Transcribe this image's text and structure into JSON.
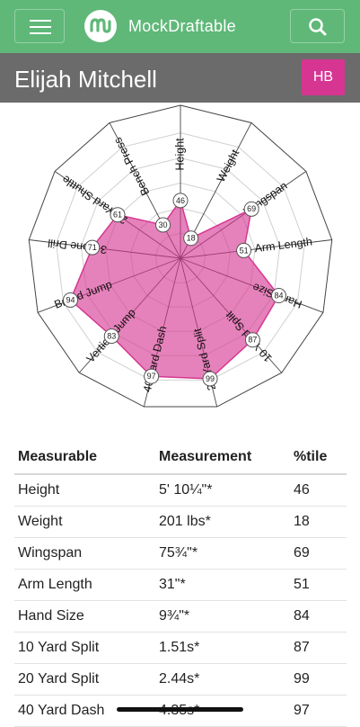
{
  "header": {
    "brand": "MockDraftable",
    "menu_icon": "hamburger-menu-icon",
    "logo_icon": "mockdraftable-logo-icon",
    "search_icon": "search-icon",
    "colors": {
      "header_bg": "#5fb878",
      "name_bar_bg": "#6b6b6b",
      "position_badge": "#d63692",
      "radar_fill": "#d63692"
    }
  },
  "player": {
    "name": "Elijah Mitchell",
    "position": "HB"
  },
  "chart_data": {
    "type": "radar",
    "max": 100,
    "axes": [
      {
        "label": "Height",
        "value": 46
      },
      {
        "label": "Weight",
        "value": 18
      },
      {
        "label": "Wingspan",
        "value": 69
      },
      {
        "label": "Arm Length",
        "value": 51
      },
      {
        "label": "Hand Size",
        "value": 84
      },
      {
        "label": "10 Yard Split",
        "value": 87
      },
      {
        "label": "20 Yard Split",
        "value": 99
      },
      {
        "label": "40 Yard Dash",
        "value": 97
      },
      {
        "label": "Vertical Jump",
        "value": 83
      },
      {
        "label": "Broad Jump",
        "value": 94
      },
      {
        "label": "3-Cone Drill",
        "value": 71
      },
      {
        "label": "20 Yard Shuttle",
        "value": 61
      },
      {
        "label": "Bench Press",
        "value": 30
      }
    ]
  },
  "table": {
    "headers": [
      "Measurable",
      "Measurement",
      "%tile"
    ],
    "rows": [
      [
        "Height",
        "5' 10¼\"*",
        "46"
      ],
      [
        "Weight",
        "201 lbs*",
        "18"
      ],
      [
        "Wingspan",
        "75¾\"*",
        "69"
      ],
      [
        "Arm Length",
        "31\"*",
        "51"
      ],
      [
        "Hand Size",
        "9¾\"*",
        "84"
      ],
      [
        "10 Yard Split",
        "1.51s*",
        "87"
      ],
      [
        "20 Yard Split",
        "2.44s*",
        "99"
      ],
      [
        "40 Yard Dash",
        "4.35s*",
        "97"
      ]
    ]
  }
}
